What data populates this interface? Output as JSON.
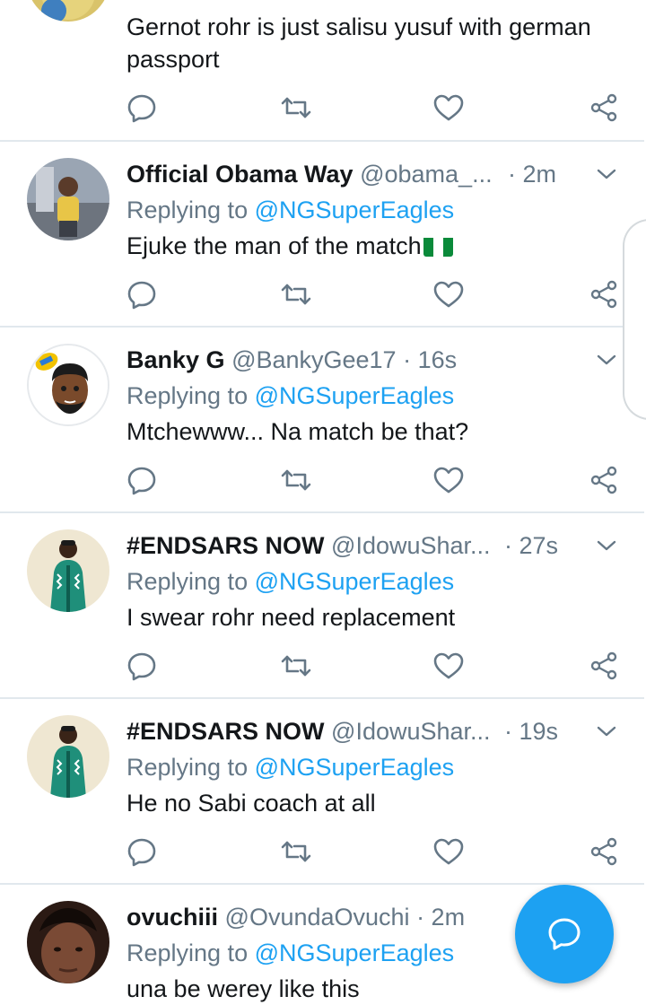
{
  "colors": {
    "link": "#1da1f2",
    "muted": "#657786",
    "text": "#14171a",
    "divider": "#e1e8ed"
  },
  "partial_tweet": {
    "text": "Gernot rohr is just  salisu yusuf with german passport"
  },
  "replying_prefix": "Replying to",
  "tweets": [
    {
      "name": "Official Obama Way",
      "handle": "@obama_...",
      "time": "· 2m",
      "reply_to": "@NGSuperEagles",
      "text": "Ejuke the man of the match",
      "emoji": "flag-nigeria"
    },
    {
      "name": "Banky G",
      "handle": "@BankyGee17",
      "time": "· 16s",
      "reply_to": "@NGSuperEagles",
      "text": "Mtchewww... Na match be that?"
    },
    {
      "name": "#ENDSARS NOW",
      "handle": "@IdowuShar...",
      "time": "· 27s",
      "reply_to": "@NGSuperEagles",
      "text": "I swear rohr need replacement"
    },
    {
      "name": "#ENDSARS NOW",
      "handle": "@IdowuShar...",
      "time": "· 19s",
      "reply_to": "@NGSuperEagles",
      "text": "He no Sabi coach at all"
    },
    {
      "name": "ovuchiii",
      "handle": "@OvundaOvuchi",
      "time": "· 2m",
      "reply_to": "@NGSuperEagles",
      "text": "una be werey like this"
    }
  ],
  "icons": {
    "reply": "reply-icon",
    "retweet": "retweet-icon",
    "like": "heart-icon",
    "share": "share-icon",
    "more": "chevron-down-icon",
    "compose": "compose-reply-icon"
  }
}
